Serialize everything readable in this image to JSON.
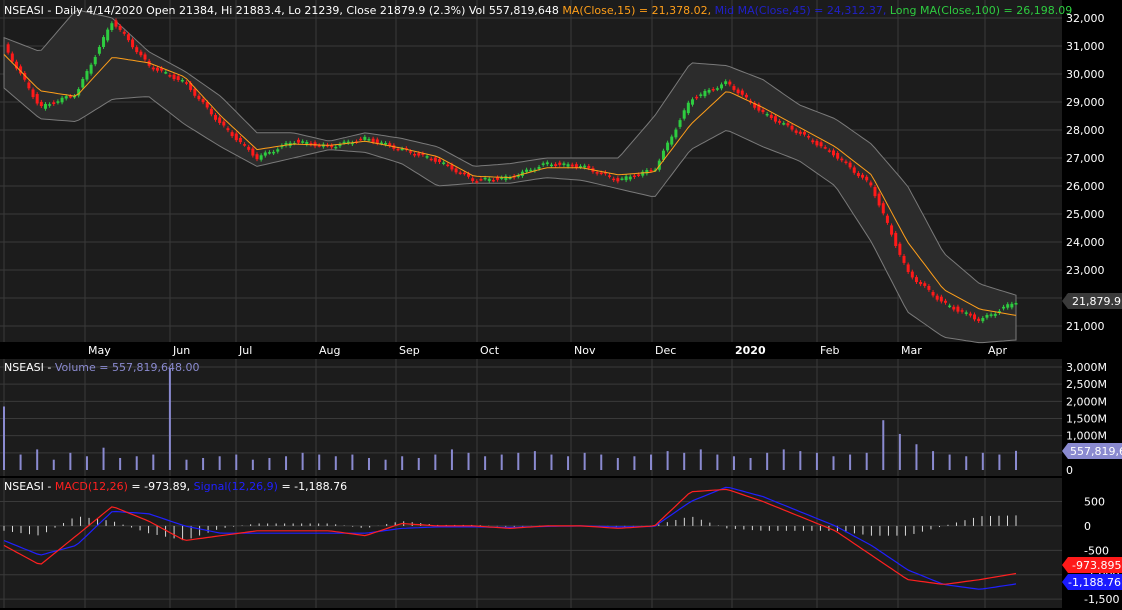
{
  "colors": {
    "background": "#000000",
    "panel": "#1c1c1c",
    "grid": "#3a3a3a",
    "text": "#ffffff",
    "up": "#2ecc40",
    "down": "#ff1a1a",
    "ma15": "#ff9f1a",
    "mid_ma45": "#1010c0",
    "long_ma100": "#2ecc40",
    "volume": "#8a8ad0",
    "macd": "#ff2020",
    "signal": "#2020ff",
    "histogram": "#d8d8d8",
    "bands": "#7a7a7a"
  },
  "price_panel": {
    "header": {
      "prefix": "NSEASI - Daily 4/14/2020 Open 21384, Hi 21883.4, Lo 21239, Close 21879.9 (2.3%) Vol 557,819,648 ",
      "ma15": "MA(Close,15) = 21,378.02,",
      "mid_ma": " Mid MA(Close,45) = 24,312.37,",
      "long_ma": " Long MA(Close,100) = 26,198.09"
    },
    "y_ticks": [
      "32,000",
      "31,000",
      "30,000",
      "29,000",
      "28,000",
      "27,000",
      "26,000",
      "25,000",
      "24,000",
      "23,000",
      "22,000",
      "21,000"
    ],
    "last_price_label": "21,879.9"
  },
  "month_labels": [
    "May",
    "Jun",
    "Jul",
    "Aug",
    "Sep",
    "Oct",
    "Nov",
    "Dec",
    "2020",
    "Feb",
    "Mar",
    "Apr"
  ],
  "volume_panel": {
    "header": "NSEASI - ",
    "series_label": "Volume = 557,819,648.00",
    "y_ticks": [
      "3,000M",
      "2,500M",
      "2,000M",
      "1,500M",
      "1,000M",
      "500M",
      "0"
    ],
    "last_label": "557,819,6"
  },
  "macd_panel": {
    "header": "NSEASI - ",
    "macd_label": "MACD(12,26)",
    "macd_value": " = -973.89, ",
    "signal_label": "Signal(12,26,9)",
    "signal_value": " = -1,188.76",
    "y_ticks": [
      "500",
      "0",
      "-500",
      "-1,000",
      "-1,500"
    ],
    "macd_last_label": "-973.895",
    "signal_last_label": "-1,188.76"
  },
  "chart_data": [
    {
      "type": "line",
      "name": "price",
      "ylim": [
        20500,
        32500
      ],
      "x": [
        "Apr",
        "May",
        "Jun",
        "Jul",
        "Aug",
        "Sep",
        "Oct",
        "Nov",
        "Dec",
        "2020",
        "Feb",
        "Mar",
        "Apr"
      ],
      "close": [
        31000,
        28800,
        29300,
        31900,
        30300,
        29700,
        28200,
        27000,
        27600,
        27400,
        27700,
        27300,
        26900,
        26200,
        26300,
        26800,
        26700,
        26200,
        26600,
        29100,
        29700,
        28600,
        27900,
        27100,
        26000,
        22900,
        21800,
        21200,
        21880
      ],
      "ma15": [
        30700,
        29400,
        29200,
        30600,
        30400,
        29900,
        28500,
        27300,
        27500,
        27450,
        27600,
        27350,
        27050,
        26350,
        26300,
        26650,
        26650,
        26400,
        26500,
        28200,
        29400,
        28800,
        28100,
        27400,
        26400,
        24000,
        22300,
        21600,
        21378
      ],
      "upper_band": [
        31300,
        30800,
        32300,
        32000,
        30800,
        30100,
        29200,
        27900,
        27900,
        27600,
        27900,
        27700,
        27400,
        26700,
        26800,
        27000,
        27000,
        27000,
        28500,
        30400,
        30300,
        29800,
        28900,
        28400,
        27500,
        26000,
        23600,
        22500,
        22100
      ],
      "lower_band": [
        29500,
        28400,
        28300,
        29100,
        29200,
        28200,
        27400,
        26700,
        27000,
        27300,
        27200,
        26800,
        26000,
        26100,
        26100,
        26300,
        26200,
        25900,
        25600,
        27300,
        28000,
        27400,
        26900,
        26000,
        24000,
        21500,
        20600,
        20400,
        20500
      ]
    },
    {
      "type": "bar",
      "name": "Volume",
      "unit": "M",
      "ylim": [
        0,
        3000
      ],
      "values": [
        1850,
        450,
        600,
        300,
        500,
        400,
        650,
        350,
        400,
        450,
        2950,
        300,
        350,
        400,
        450,
        300,
        350,
        400,
        500,
        450,
        400,
        450,
        350,
        300,
        400,
        350,
        450,
        600,
        500,
        400,
        450,
        500,
        550,
        450,
        400,
        500,
        450,
        350,
        400,
        450,
        550,
        500,
        600,
        450,
        400,
        350,
        500,
        600,
        550,
        500,
        400,
        450,
        500,
        1450,
        1050,
        750,
        550,
        450,
        400,
        500,
        450,
        558
      ]
    },
    {
      "type": "line",
      "name": "MACD",
      "ylim": [
        -1600,
        900
      ],
      "macd": [
        -400,
        -800,
        -200,
        400,
        100,
        -300,
        -200,
        -100,
        -100,
        -100,
        -200,
        50,
        0,
        0,
        -50,
        0,
        0,
        -50,
        0,
        700,
        750,
        500,
        200,
        -100,
        -600,
        -1100,
        -1200,
        -1100,
        -974
      ],
      "signal": [
        -300,
        -600,
        -400,
        300,
        250,
        0,
        -150,
        -150,
        -150,
        -150,
        -150,
        -50,
        -20,
        -20,
        -30,
        -10,
        0,
        -20,
        -10,
        500,
        800,
        600,
        300,
        0,
        -400,
        -900,
        -1200,
        -1300,
        -1189
      ],
      "histogram": [
        -100,
        -200,
        200,
        100,
        -150,
        -300,
        -50,
        50,
        50,
        50,
        -50,
        100,
        20,
        20,
        -20,
        10,
        0,
        -30,
        10,
        200,
        -50,
        -100,
        -100,
        -100,
        -200,
        -200,
        0,
        200,
        215
      ]
    }
  ]
}
